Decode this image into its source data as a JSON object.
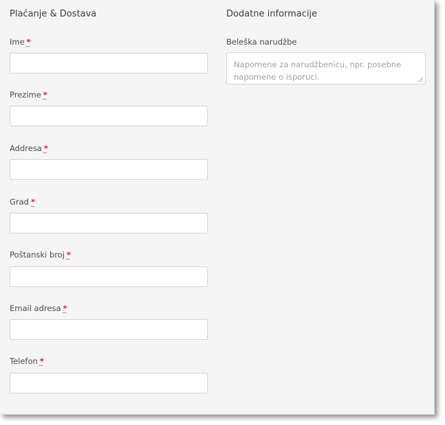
{
  "billing": {
    "title": "Plaćanje & Dostava",
    "required_mark": "*",
    "fields": [
      {
        "label": "Ime",
        "value": ""
      },
      {
        "label": "Prezime",
        "value": ""
      },
      {
        "label": "Addresa",
        "value": ""
      },
      {
        "label": "Grad",
        "value": ""
      },
      {
        "label": "Poštanski broj",
        "value": ""
      },
      {
        "label": "Email adresa",
        "value": ""
      },
      {
        "label": "Telefon",
        "value": ""
      }
    ]
  },
  "additional": {
    "title": "Dodatne informacije",
    "notes_label": "Beleška narudžbe",
    "notes_placeholder": "Napomene za narudžbenicu, npr. posebne napomene o isporuci.",
    "notes_value": ""
  }
}
